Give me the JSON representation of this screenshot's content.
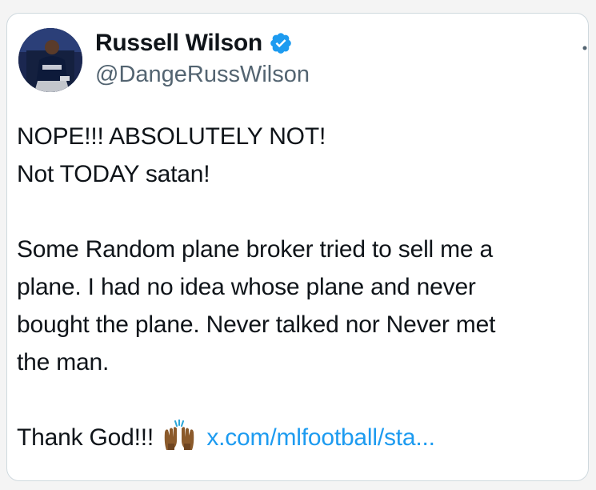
{
  "tweet": {
    "author_name": "Russell Wilson",
    "handle": "@DangeRussWilson",
    "verified": true,
    "lines_block1": [
      "NOPE!!! ABSOLUTELY NOT!",
      "Not TODAY satan!"
    ],
    "lines_block2": [
      "Some Random plane broker tried to sell me a",
      "plane. I had no idea whose plane and never",
      "bought the plane. Never talked nor Never met",
      "the man."
    ],
    "closing_text": "Thank God!!!",
    "closing_emoji": "raised-hands-emoji",
    "link_text": "x.com/mlfootball/sta..."
  },
  "colors": {
    "link": "#1d9bf0",
    "verified_badge": "#1d9bf0",
    "handle": "#536471",
    "border": "#cfd9de"
  },
  "icons": {
    "verified": "verified-badge-icon",
    "more": "more-options-icon"
  }
}
